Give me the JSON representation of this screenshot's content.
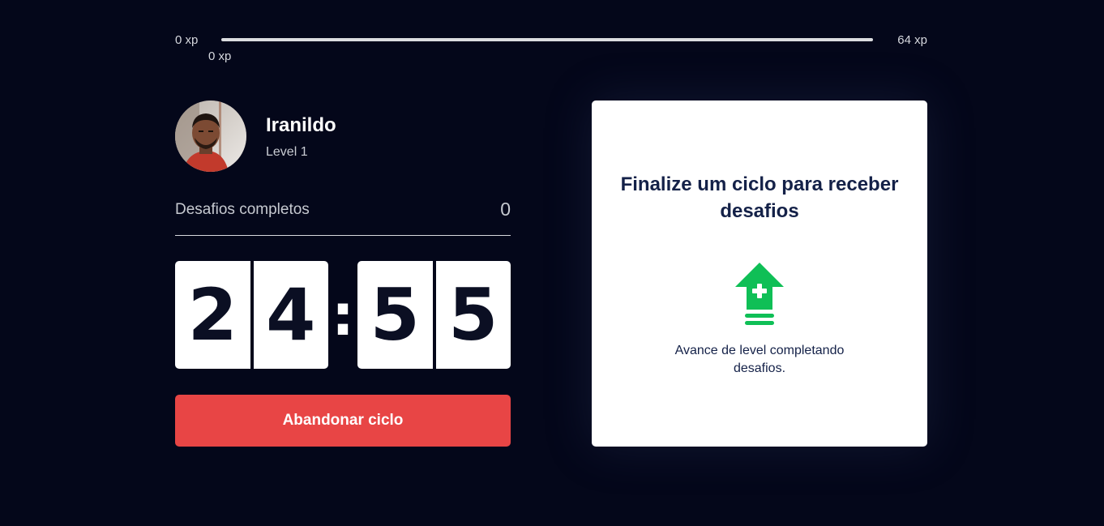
{
  "experience": {
    "min_label": "0 xp",
    "max_label": "64 xp",
    "current_label": "0 xp",
    "progress_fraction": 0,
    "track_color": "#dcdde0"
  },
  "profile": {
    "name": "Iranildo",
    "level": "Level 1",
    "avatar_icon": "user-photo"
  },
  "challenges": {
    "label": "Desafios completos",
    "count": "0"
  },
  "countdown": {
    "minute_tens": "2",
    "minute_ones": "4",
    "separator": ":",
    "second_tens": "5",
    "second_ones": "5"
  },
  "actions": {
    "abandon_label": "Abandonar ciclo",
    "abandon_color": "#e84545"
  },
  "challenge_card": {
    "title": "Finalize um ciclo para receber desafios",
    "icon": "level-up-icon",
    "icon_color": "#0fbf56",
    "description": "Avance de level completando desafios."
  },
  "colors": {
    "background": "#04071a",
    "card_background": "#ffffff",
    "title_text": "#142148"
  }
}
